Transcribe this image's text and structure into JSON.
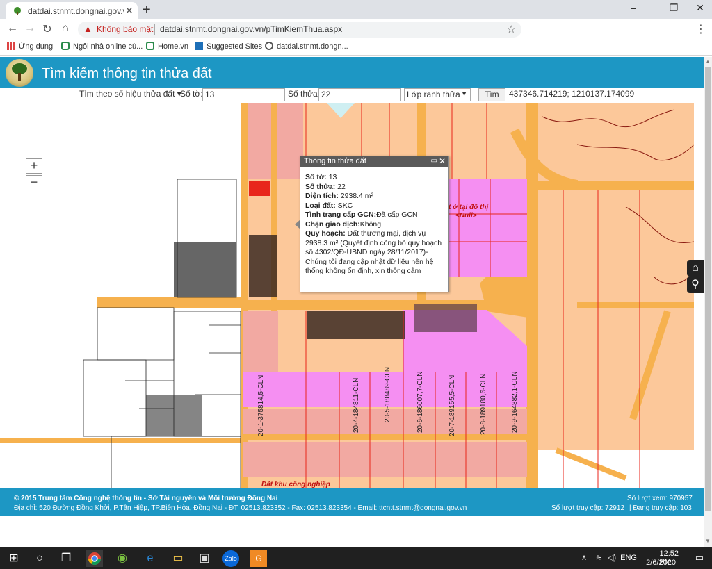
{
  "browser": {
    "tab_title": "datdai.stnmt.dongnai.gov.vn/pTi",
    "security_label": "Không bảo mật",
    "url": "datdai.stnmt.dongnai.gov.vn/pTimKiemThua.aspx",
    "bookmarks": [
      {
        "label": "Ứng dụng",
        "icon": "apps-grid-icon"
      },
      {
        "label": "Ngôi nhà online cù...",
        "icon": "house-icon"
      },
      {
        "label": "Home.vn",
        "icon": "house-icon"
      },
      {
        "label": "Suggested Sites",
        "icon": "bing-icon"
      },
      {
        "label": "datdai.stnmt.dongn...",
        "icon": "globe-icon"
      }
    ]
  },
  "page": {
    "title": "Tìm kiếm thông tin thửa đất",
    "search": {
      "mode_label": "Tìm theo số hiệu thửa đất",
      "sheet_label": "Số tờ:",
      "sheet_value": "13",
      "parcel_label": "Số thửa:",
      "parcel_value": "22",
      "layer_select": "Lớp ranh thửa",
      "search_button": "Tìm",
      "coordinates": "437346.714219; 1210137.174099"
    },
    "map": {
      "zoom_in": "+",
      "zoom_out": "−",
      "labels": {
        "residential": "t ở tại đô thị",
        "null_label": "<Null>",
        "industrial": "Đất khu công nghiệp",
        "parcel_codes": [
          "20-1-375814,5-CLN",
          "20-4-184811-CLN",
          "20-5-188489-CLN",
          "20-6-186007,7-CLN",
          "20-7-189155,5-CLN",
          "20-8-189180,6-CLN",
          "20-9-164882,1-CLN"
        ]
      }
    },
    "popup": {
      "title": "Thông tin thửa đất",
      "rows": [
        {
          "label": "Số tờ:",
          "value": " 13"
        },
        {
          "label": "Số thửa:",
          "value": " 22"
        },
        {
          "label": "Diện tích:",
          "value": " 2938.4 m²"
        },
        {
          "label": "Loại đất:",
          "value": " SKC"
        },
        {
          "label": "Tình trạng cấp GCN:",
          "value": "Đã cấp GCN"
        },
        {
          "label": "Chặn giao dịch:",
          "value": "Không"
        },
        {
          "label": "Quy hoạch:",
          "value": " Đất thương mại, dịch vụ"
        }
      ],
      "note": "2938.3 m² (Quyết định công bố quy hoạch số 4302/QĐ-UBND ngày 28/11/2017)- Chúng tôi đang cập nhật dữ liệu nên hệ thống không ổn định, xin thông cảm"
    },
    "footer": {
      "line1": "© 2015 Trung tâm Công nghệ thông tin - Sở Tài nguyên và Môi trường Đồng Nai",
      "line2": "Địa chỉ: 520 Đường Đồng Khởi, P.Tân Hiệp, TP.Biên Hòa, Đồng Nai - ĐT: 02513.823352 - Fax: 02513.823354 - Email: ttcntt.stnmt@dongnai.gov.vn",
      "views": "Số lượt xem: 970957",
      "visits": "Số lượt truy cập: 72912",
      "online": "| Đang truy cập: 103"
    }
  },
  "taskbar": {
    "time": "12:52 PM",
    "date": "2/6/2020",
    "lang": "ENG"
  },
  "colors": {
    "header_blue": "#1d97c4",
    "parcel_orange": "#fcc89a",
    "road_orange": "#f6b14e",
    "commercial_pink": "#f2a9a2",
    "industrial_magenta": "#f58ff2",
    "boundary_red": "#e8261b"
  }
}
